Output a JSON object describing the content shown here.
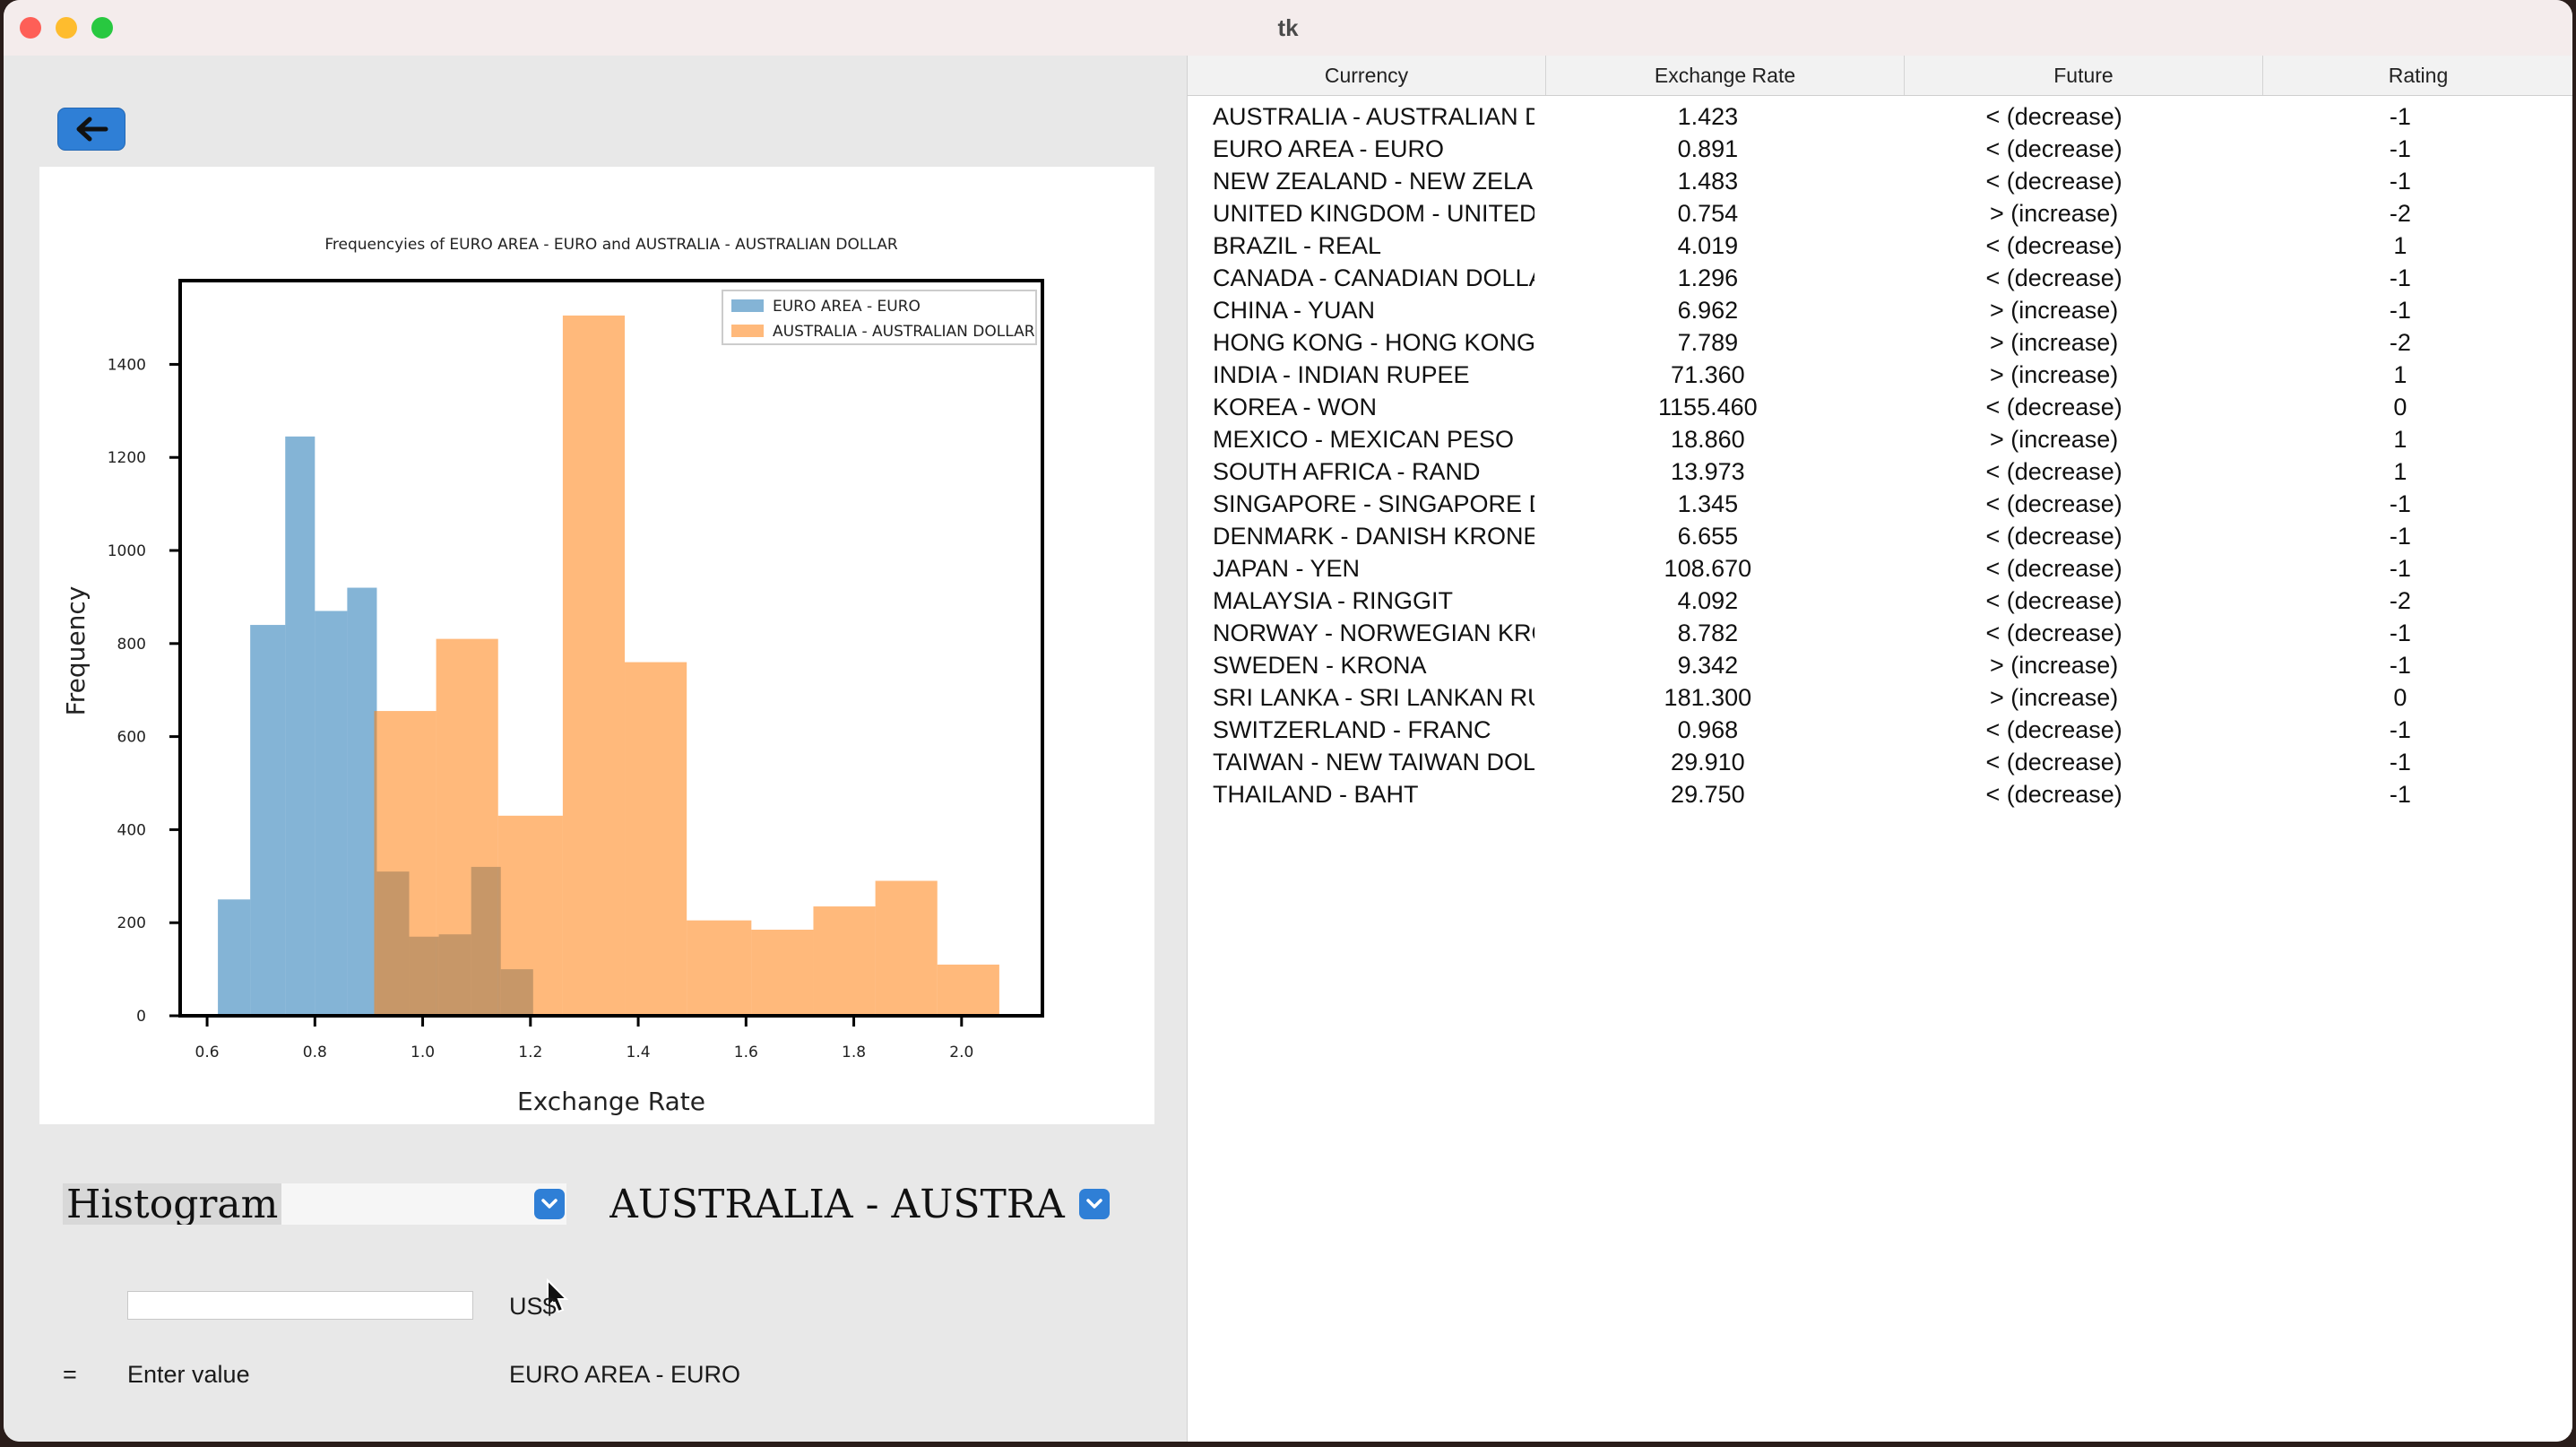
{
  "window": {
    "title": "tk"
  },
  "left": {
    "chart_type_combo": {
      "value": "Histogram"
    },
    "currency_combo": {
      "value": "AUSTRALIA - AUSTRA"
    },
    "amount_input": {
      "value": ""
    },
    "usd_label": "US$",
    "equals_label": "=",
    "result_label": "Enter value",
    "target_currency_label": "EURO AREA - EURO"
  },
  "chart_data": {
    "type": "bar",
    "title": "Frequencyies of EURO AREA - EURO and AUSTRALIA - AUSTRALIAN DOLLAR",
    "xlabel": "Exchange Rate",
    "ylabel": "Frequency",
    "xlim": [
      0.55,
      2.15
    ],
    "ylim": [
      0,
      1580
    ],
    "xticks": [
      "0.6",
      "0.8",
      "1.0",
      "1.2",
      "1.4",
      "1.6",
      "1.8",
      "2.0"
    ],
    "yticks": [
      "0",
      "200",
      "400",
      "600",
      "800",
      "1000",
      "1200",
      "1400"
    ],
    "legend_position": "top-right",
    "series": [
      {
        "name": "EURO AREA - EURO",
        "color": "#1f77b4",
        "bins": [
          {
            "x0": 0.62,
            "x1": 0.68,
            "value": 250
          },
          {
            "x0": 0.68,
            "x1": 0.745,
            "value": 840
          },
          {
            "x0": 0.745,
            "x1": 0.8,
            "value": 1245
          },
          {
            "x0": 0.8,
            "x1": 0.86,
            "value": 870
          },
          {
            "x0": 0.86,
            "x1": 0.915,
            "value": 920
          },
          {
            "x0": 0.915,
            "x1": 0.975,
            "value": 310
          },
          {
            "x0": 0.975,
            "x1": 1.03,
            "value": 170
          },
          {
            "x0": 1.03,
            "x1": 1.09,
            "value": 175
          },
          {
            "x0": 1.09,
            "x1": 1.145,
            "value": 320
          },
          {
            "x0": 1.145,
            "x1": 1.205,
            "value": 100
          }
        ]
      },
      {
        "name": "AUSTRALIA - AUSTRALIAN DOLLAR",
        "color": "#ff7f0e",
        "bins": [
          {
            "x0": 0.91,
            "x1": 1.025,
            "value": 655
          },
          {
            "x0": 1.025,
            "x1": 1.14,
            "value": 810
          },
          {
            "x0": 1.14,
            "x1": 1.26,
            "value": 430
          },
          {
            "x0": 1.26,
            "x1": 1.375,
            "value": 1505
          },
          {
            "x0": 1.375,
            "x1": 1.49,
            "value": 760
          },
          {
            "x0": 1.49,
            "x1": 1.61,
            "value": 205
          },
          {
            "x0": 1.61,
            "x1": 1.725,
            "value": 185
          },
          {
            "x0": 1.725,
            "x1": 1.84,
            "value": 235
          },
          {
            "x0": 1.84,
            "x1": 1.955,
            "value": 290
          },
          {
            "x0": 1.955,
            "x1": 2.07,
            "value": 110
          }
        ]
      }
    ]
  },
  "table": {
    "columns": [
      "Currency",
      "Exchange Rate",
      "Future",
      "Rating"
    ],
    "rows": [
      [
        "AUSTRALIA - AUSTRALIAN DO",
        "1.423",
        "< (decrease)",
        "-1"
      ],
      [
        "EURO AREA - EURO",
        "0.891",
        "< (decrease)",
        "-1"
      ],
      [
        "NEW ZEALAND - NEW ZELANE",
        "1.483",
        "< (decrease)",
        "-1"
      ],
      [
        "UNITED KINGDOM - UNITED KI",
        "0.754",
        "> (increase)",
        "-2"
      ],
      [
        "BRAZIL - REAL",
        "4.019",
        "< (decrease)",
        "1"
      ],
      [
        "CANADA - CANADIAN DOLLAR",
        "1.296",
        "< (decrease)",
        "-1"
      ],
      [
        "CHINA - YUAN",
        "6.962",
        "> (increase)",
        "-1"
      ],
      [
        "HONG KONG - HONG KONG D",
        "7.789",
        "> (increase)",
        "-2"
      ],
      [
        "INDIA - INDIAN RUPEE",
        "71.360",
        "> (increase)",
        "1"
      ],
      [
        "KOREA - WON",
        "1155.460",
        "< (decrease)",
        "0"
      ],
      [
        "MEXICO - MEXICAN PESO",
        "18.860",
        "> (increase)",
        "1"
      ],
      [
        "SOUTH AFRICA - RAND",
        "13.973",
        "< (decrease)",
        "1"
      ],
      [
        "SINGAPORE - SINGAPORE DOI",
        "1.345",
        "< (decrease)",
        "-1"
      ],
      [
        "DENMARK - DANISH KRONE",
        "6.655",
        "< (decrease)",
        "-1"
      ],
      [
        "JAPAN - YEN",
        "108.670",
        "< (decrease)",
        "-1"
      ],
      [
        "MALAYSIA - RINGGIT",
        "4.092",
        "< (decrease)",
        "-2"
      ],
      [
        "NORWAY - NORWEGIAN KRON",
        "8.782",
        "< (decrease)",
        "-1"
      ],
      [
        "SWEDEN - KRONA",
        "9.342",
        "> (increase)",
        "-1"
      ],
      [
        "SRI LANKA - SRI LANKAN RUPI",
        "181.300",
        "> (increase)",
        "0"
      ],
      [
        "SWITZERLAND - FRANC",
        "0.968",
        "< (decrease)",
        "-1"
      ],
      [
        "TAIWAN - NEW TAIWAN DOLL",
        "29.910",
        "< (decrease)",
        "-1"
      ],
      [
        "THAILAND - BAHT",
        "29.750",
        "< (decrease)",
        "-1"
      ]
    ]
  },
  "icons": {
    "back": "arrow-left-icon",
    "dropdown": "chevron-down-icon",
    "pointer": "mouse-pointer-icon"
  }
}
